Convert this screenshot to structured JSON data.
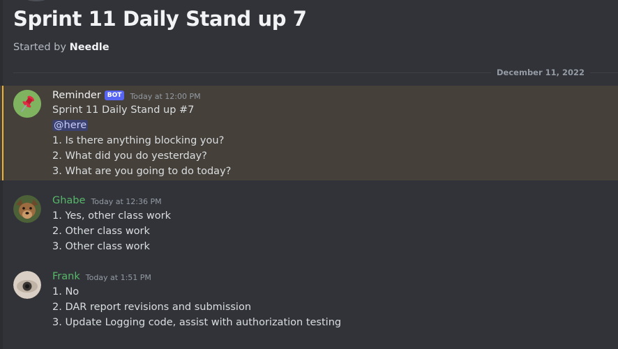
{
  "thread": {
    "title": "Sprint 11 Daily Stand up 7",
    "started_by_prefix": "Started by",
    "started_by_name": "Needle"
  },
  "divider": {
    "date": "December 11, 2022"
  },
  "messages": [
    {
      "username": "Reminder",
      "bot_tag": "BOT",
      "timestamp": "Today at 12:00 PM",
      "lines": [
        "Sprint 11 Daily Stand up #7",
        "@here",
        "1. Is there anything blocking you?",
        "2. What did you do yesterday?",
        "3. What are you going to do today?"
      ],
      "avatar_icon": "pushpin-icon",
      "username_color": "#f2f3f5"
    },
    {
      "username": "Ghabe",
      "timestamp": "Today at 12:36 PM",
      "lines": [
        "1. Yes, other class work",
        "2. Other class work",
        "3. Other class work"
      ],
      "username_color": "#57b86a"
    },
    {
      "username": "Frank",
      "timestamp": "Today at 1:51 PM",
      "lines": [
        "1. No",
        "2. DAR report revisions and submission",
        "3. Update Logging code, assist with authorization testing"
      ],
      "username_color": "#57b86a"
    }
  ],
  "colors": {
    "background": "#313338",
    "mention_highlight": "#45403a",
    "mention_bar": "#f0b232",
    "bot_tag": "#5865f2"
  }
}
